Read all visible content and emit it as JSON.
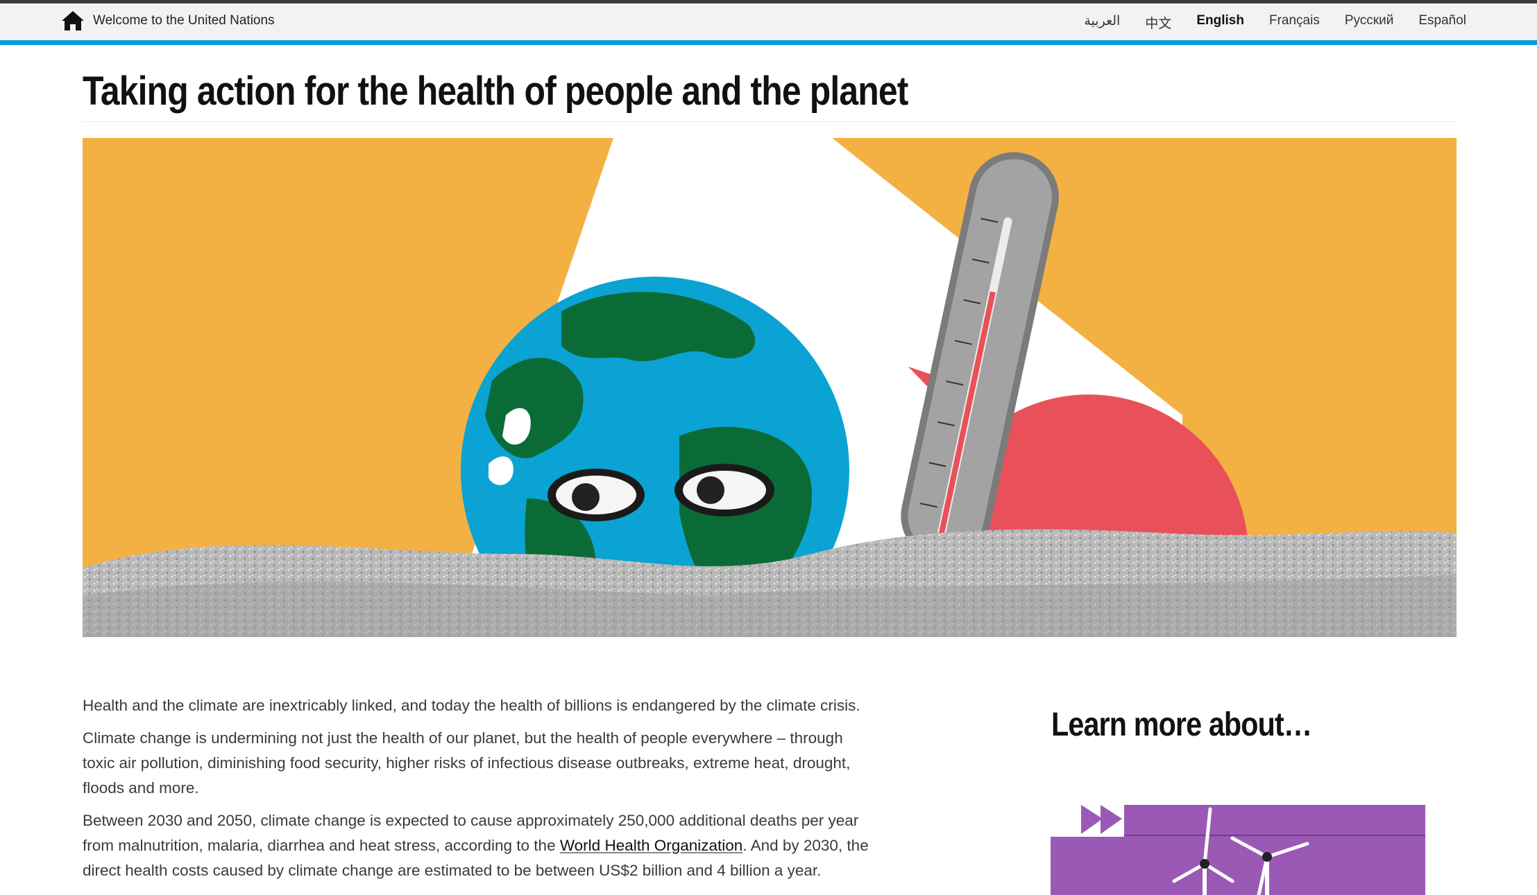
{
  "topbar": {
    "home_label": "Welcome to the United Nations",
    "languages": [
      {
        "label": "العربية",
        "active": false
      },
      {
        "label": "中文",
        "active": false
      },
      {
        "label": "English",
        "active": true
      },
      {
        "label": "Français",
        "active": false
      },
      {
        "label": "Русский",
        "active": false
      },
      {
        "label": "Español",
        "active": false
      }
    ]
  },
  "page": {
    "title": "Taking action for the health of people and the planet"
  },
  "article": {
    "p1": "Health and the climate are inextricably linked, and today the health of billions is endangered by the climate crisis.",
    "p2": "Climate change is undermining not just the health of our planet, but the health of people everywhere – through toxic air pollution, diminishing food security, higher risks of infectious disease outbreaks, extreme heat, drought, floods and more.",
    "p3_before": "Between 2030 and 2050, climate change is expected to cause approximately 250,000 additional deaths per year from malnutrition, malaria, diarrhea and heat stress, according to the ",
    "p3_link": "World Health Organization",
    "p3_after": ". And by 2030, the direct health costs caused by climate change are estimated to be between US$2 billion and 4 billion a year."
  },
  "sidebar": {
    "heading": "Learn more about…"
  },
  "colors": {
    "accent": "#009edb",
    "hero_orange": "#f3b143",
    "sun_red": "#e9515a",
    "globe_blue": "#0aa3d3",
    "land_green": "#0b6b36",
    "card_purple": "#9b59b6"
  }
}
